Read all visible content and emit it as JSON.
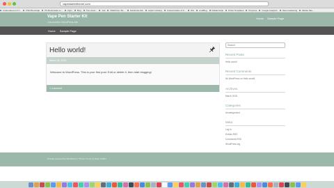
{
  "browser": {
    "url": "vapestartertheme.com",
    "bookmarks": [
      "Unbounded on FT...",
      "PSD Bootstrap",
      "PS Bookmarks to...",
      "Apps",
      "Bing",
      "The cloud...",
      "Ask",
      "Mailchimp: Bo...",
      "Facebook Ads",
      "Jupiter Hosting",
      "Customization of F...",
      "Wix",
      "LiveBlog",
      "Relationship",
      "Photo Templates",
      "Prepress",
      "Google Analytics",
      "Neuromarketing",
      "Mobile Site..."
    ]
  },
  "header": {
    "site_title": "Vape Pen Starter Kit",
    "site_description": "Just another WordPress site",
    "nav": [
      "Home",
      "Sample Page"
    ]
  },
  "main_nav": [
    "Home",
    "Sample Page"
  ],
  "post": {
    "title": "Hello world!",
    "meta": "March 26, 2015",
    "content": "Welcome to WordPress. This is your first post. Edit or delete it, then start blogging!",
    "comments": "1 Comment",
    "pin_icon": "thumbtack-icon"
  },
  "sidebar": {
    "search_placeholder": "Search",
    "widgets": [
      {
        "title": "Recent Posts",
        "items": [
          "Hello world!"
        ]
      },
      {
        "title": "Recent Comments",
        "items": [
          "Mr WordPress on Hello world!"
        ]
      },
      {
        "title": "Archives",
        "items": [
          "March 2015"
        ]
      },
      {
        "title": "Categories",
        "items": [
          "Uncategorized"
        ]
      },
      {
        "title": "Meta",
        "items": [
          "Log in",
          "Entries RSS",
          "Comments RSS",
          "WordPress.org"
        ]
      }
    ]
  },
  "footer": {
    "text": "Proudly powered by WordPress | Theme: Fruity by Ryan Tedder"
  },
  "colors": {
    "header_bg": "#9cb8ab",
    "nav_bg": "#545454",
    "accent": "#8aa79a"
  },
  "dock": {
    "icon_colors": [
      "#6d8fc7",
      "#e1a04a",
      "#c94b4b",
      "#8cc152",
      "#5d9cec",
      "#f6bb42",
      "#967adc",
      "#4fc1e9",
      "#ed5565",
      "#48cfad",
      "#ac92ec",
      "#a0d468",
      "#ffce54",
      "#656d78",
      "#3bafda",
      "#e9573f",
      "#37bc9b",
      "#d770ad",
      "#434a54",
      "#fc6e51",
      "#4a89dc",
      "#8cc152",
      "#aab2bd",
      "#da4453",
      "#f5f7fa",
      "#5d9cec",
      "#ffce54",
      "#ed5565",
      "#48cfad",
      "#967adc",
      "#e1a04a",
      "#6d8fc7",
      "#c94b4b",
      "#a0d468",
      "#4fc1e9",
      "#d770ad",
      "#656d78",
      "#3bafda",
      "#f6bb42",
      "#37bc9b",
      "#e9573f",
      "#ac92ec",
      "#4a89dc",
      "#fc6e51",
      "#aab2bd",
      "#da4453",
      "#434a54",
      "#8cc152",
      "#5d9cec",
      "#ffce54"
    ]
  }
}
